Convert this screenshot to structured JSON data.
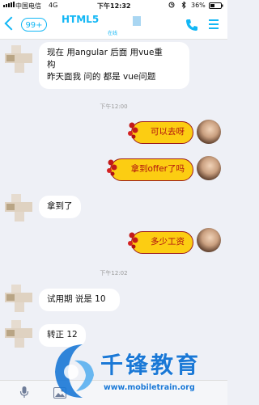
{
  "status_bar": {
    "carrier": "中国电信",
    "network": "4G",
    "time": "下午12:32",
    "battery": "36%"
  },
  "nav": {
    "unread": "99+",
    "contact_name": "HTML5",
    "online": "在线"
  },
  "messages": [
    {
      "line1": "现在 用angular 后面 用vue重",
      "line2": "构",
      "line3": "昨天面我 问的 都是 vue问题"
    },
    {
      "time": "下午12:00"
    },
    {
      "text": "可以去呀"
    },
    {
      "text": "拿到offer了吗"
    },
    {
      "text": "拿到了"
    },
    {
      "text": "多少工资"
    },
    {
      "time": "下午12:02"
    },
    {
      "text": "试用期 说是 10"
    },
    {
      "text": "转正 12"
    }
  ],
  "watermark": {
    "title": "千锋教育",
    "url": "www.mobiletrain.org"
  },
  "colors": {
    "accent": "#12b7f5",
    "bubble_out": "#fccd12",
    "bubble_out_text": "#b01010",
    "background": "#eef0f6"
  },
  "icons": [
    "back-chevron-icon",
    "phone-icon",
    "menu-icon",
    "microphone-icon",
    "image-icon"
  ]
}
